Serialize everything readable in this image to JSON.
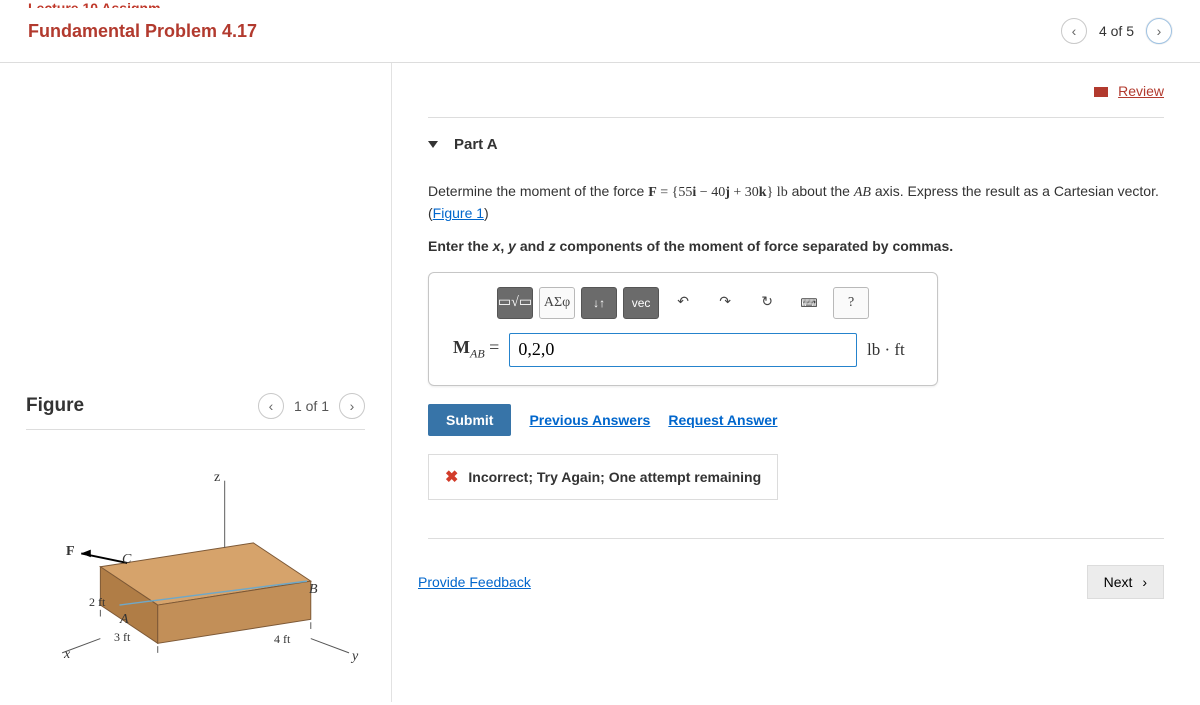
{
  "breadcrumb": "Lecture 10 Assignm...",
  "header": {
    "title": "Fundamental Problem 4.17",
    "page_label": "4 of 5"
  },
  "review": {
    "label": "Review"
  },
  "part": {
    "title": "Part A",
    "prompt_pre": "Determine the moment of the force ",
    "force_expr": "F = {55i − 40j + 30k} lb",
    "prompt_mid": " about the ",
    "axis": "AB",
    "prompt_post": " axis. Express the result as a Cartesian vector. (",
    "figure_link": "Figure 1",
    "prompt_close": ")",
    "instruction": "Enter the x, y and z components of the moment of force separated by commas.",
    "toolbar": {
      "template": "▭√▭",
      "greek": "ΑΣφ",
      "updown": "↓↑",
      "vec": "vec",
      "undo": "↶",
      "redo": "↷",
      "reset": "↻",
      "keyboard": "⌨",
      "help": "?"
    },
    "eq_label": "M",
    "eq_sub": "AB",
    "eq_equals": " = ",
    "answer_value": "0,2,0",
    "unit": "lb · ft",
    "submit": "Submit",
    "prev_answers": "Previous Answers",
    "request_answer": "Request Answer",
    "feedback": "Incorrect; Try Again; One attempt remaining"
  },
  "footer": {
    "provide_feedback": "Provide Feedback",
    "next": "Next"
  },
  "figure": {
    "title": "Figure",
    "pager": "1 of 1",
    "labels": {
      "F": "F",
      "C": "C",
      "B": "B",
      "A": "A",
      "x": "x",
      "y": "y",
      "z": "z",
      "d2ft": "2 ft",
      "d3ft": "3 ft",
      "d4ft": "4 ft"
    }
  }
}
